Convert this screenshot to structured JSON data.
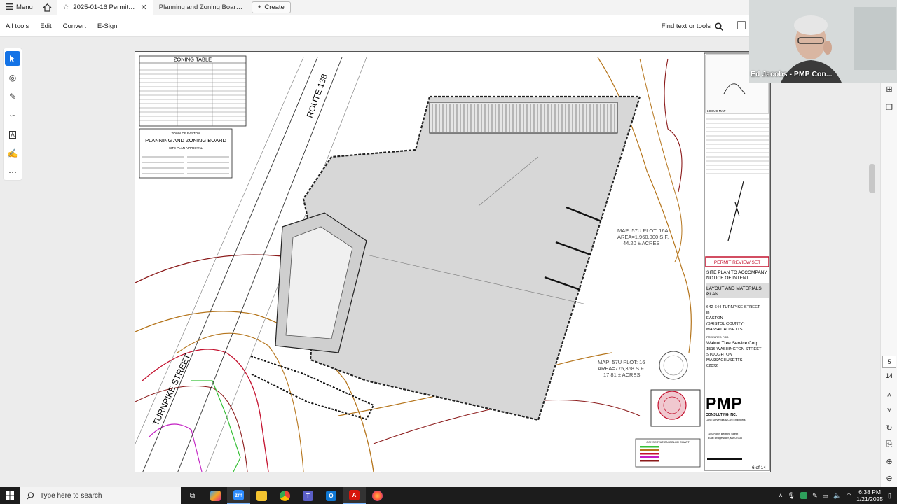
{
  "tabbar": {
    "menu_label": "Menu",
    "tabs": [
      {
        "title": "2025-01-16 Permit Revie...",
        "active": true
      },
      {
        "title": "Planning and Zoning Board Age...",
        "active": false
      }
    ],
    "create_label": "Create"
  },
  "toolbar": {
    "items": [
      "All tools",
      "Edit",
      "Convert",
      "E-Sign"
    ],
    "find_label": "Find text or tools"
  },
  "video": {
    "participant": "Ed Jacobs - PMP Con..."
  },
  "pdf": {
    "page_current": "5",
    "page_total": "14"
  },
  "drawing": {
    "zoning_table_title": "ZONING TABLE",
    "board_town": "TOWN OF EASTON",
    "board_title": "PLANNING AND ZONING BOARD",
    "board_subtitle": "SITE PLAN APPROVAL",
    "route_label": "ROUTE 138",
    "turnpike_label": "TURNPIKE STREET",
    "plot_16a": [
      "MAP: 57U PLOT: 16A",
      "AREA=1,960,000 S.F.",
      "44.20 ± ACRES"
    ],
    "plot_16": [
      "MAP: 57U PLOT: 16",
      "AREA=775,368 S.F.",
      "17.81 ± ACRES"
    ],
    "permit_review_set": "PERMIT REVIEW SET",
    "site_plan_notice": [
      "SITE PLAN TO ACCOMPANY",
      "NOTICE OF INTENT"
    ],
    "sheet_title": [
      "LAYOUT AND MATERIALS",
      "PLAN"
    ],
    "address": [
      "642-644 TURNPIKE STREET",
      "in",
      "EASTON",
      "(BRISTOL COUNTY)",
      "MASSACHUSETTS"
    ],
    "prepared_for_label": "PREPARED FOR:",
    "client": [
      "Walnut Tree Service Corp",
      "1516 WASHINGTON STREET",
      "STOUGHTON",
      "MASSACHUSETTS",
      "02072"
    ],
    "locus_map_label": "LOCUS MAP",
    "company_name": "PMP",
    "company_sub": "CONSULTING INC.",
    "company_tagline": "Land Surveyors & Civil Engineers",
    "company_address": [
      "100 North Bedford Street",
      "East Bridgewater, MA 02333"
    ],
    "conservation_chart_title": "CONSERVATION COLOR CHART",
    "sheet_number": "6 of 14"
  },
  "taskbar": {
    "search_placeholder": "Type here to search",
    "time": "6:38 PM",
    "date": "1/21/2025"
  },
  "colors": {
    "accent_blue": "#1473e6",
    "permit_red": "#c4122f",
    "taskbar": "#1c1c1c"
  }
}
